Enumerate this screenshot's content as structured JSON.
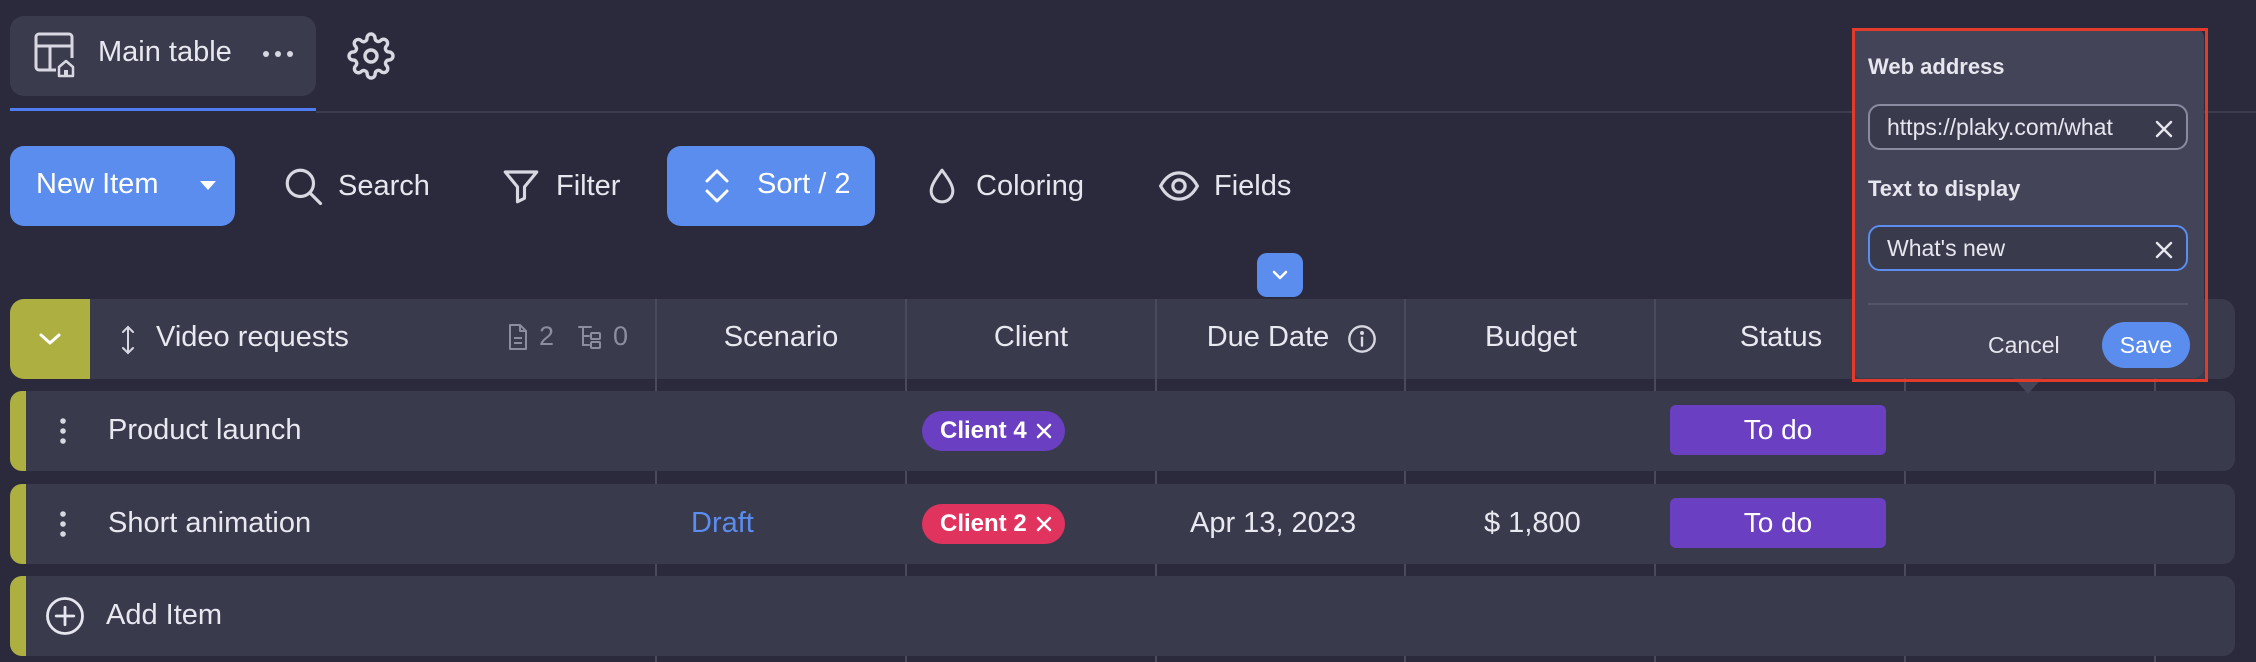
{
  "tabs": {
    "main_table_label": "Main table"
  },
  "toolbar": {
    "new_item_label": "New Item",
    "search_label": "Search",
    "filter_label": "Filter",
    "sort_label": "Sort / 2",
    "coloring_label": "Coloring",
    "fields_label": "Fields"
  },
  "table": {
    "group_title": "Video requests",
    "doc_count": "2",
    "subitem_count": "0",
    "columns": {
      "scenario": "Scenario",
      "client": "Client",
      "due_date": "Due Date",
      "budget": "Budget",
      "status": "Status"
    },
    "rows": [
      {
        "name": "Product launch",
        "scenario": "",
        "client": "Client 4",
        "due_date": "",
        "budget": "",
        "status": "To do"
      },
      {
        "name": "Short animation",
        "scenario": "Draft",
        "client": "Client 2",
        "due_date": "Apr 13, 2023",
        "budget": "$ 1,800",
        "status": "To do"
      }
    ],
    "add_item_label": "Add Item"
  },
  "popover": {
    "web_address_label": "Web address",
    "web_address_value": "https://plaky.com/what",
    "text_to_display_label": "Text to display",
    "text_to_display_value": "What's new",
    "cancel_label": "Cancel",
    "save_label": "Save"
  },
  "colors": {
    "accent_blue": "#5b8def",
    "group_color": "#adb040",
    "status_todo": "#6a3fc1",
    "client4_chip": "#6a3fc1",
    "client2_chip": "#e0335e",
    "highlight_frame": "#e23b2a"
  }
}
